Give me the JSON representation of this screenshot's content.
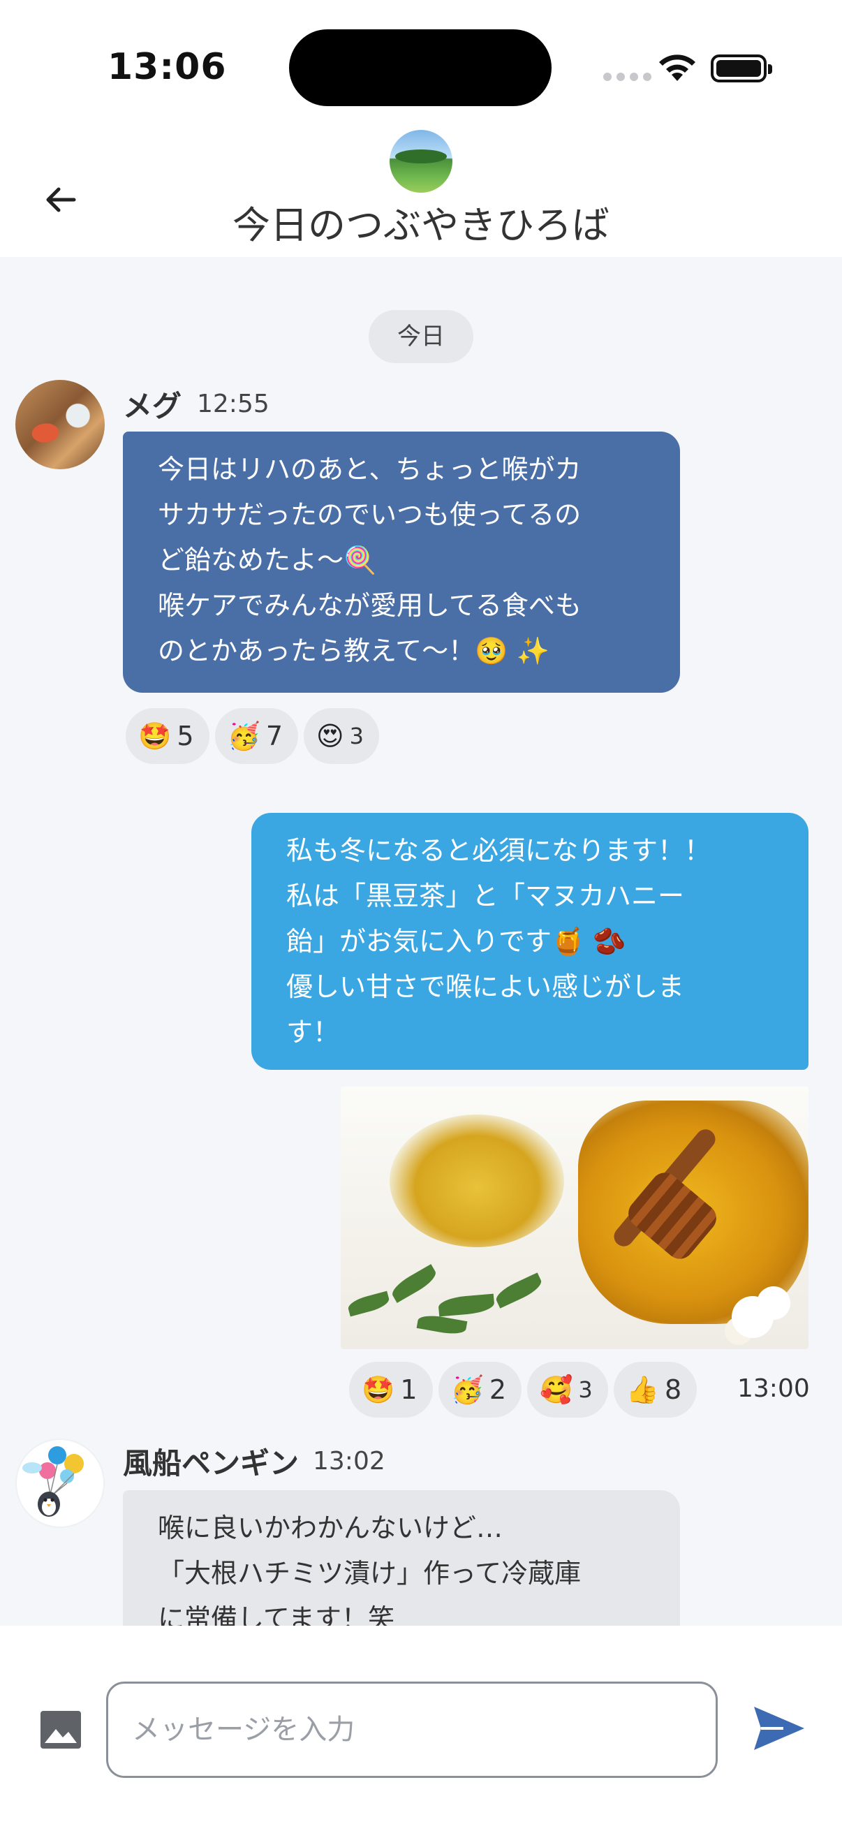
{
  "status_bar": {
    "time": "13:06"
  },
  "header": {
    "title": "今日のつぶやきひろば"
  },
  "chat": {
    "date_separator": "今日",
    "messages": [
      {
        "sender": "メグ",
        "time": "12:55",
        "lines": [
          "今日はリハのあと、ちょっと喉がカ",
          "サカサだったのでいつも使ってるの",
          "ど飴なめたよ〜🍭",
          "喉ケアでみんなが愛用してる食べも",
          "のとかあったら教えて〜！🥹 ✨"
        ],
        "reactions": [
          {
            "emoji": "🤩",
            "count": "5"
          },
          {
            "emoji": "🥳",
            "count": "7"
          },
          {
            "emoji": "😍",
            "count": "3"
          }
        ]
      },
      {
        "sender": "me",
        "time": "13:00",
        "lines": [
          "私も冬になると必須になります！！",
          "私は「黒豆茶」と「マヌカハニー",
          "飴」がお気に入りです🍯 🫘",
          "優しい甘さで喉によい感じがしま",
          "す！"
        ],
        "reactions": [
          {
            "emoji": "🤩",
            "count": "1"
          },
          {
            "emoji": "🥳",
            "count": "2"
          },
          {
            "emoji": "🥰",
            "count": "3"
          },
          {
            "emoji": "👍",
            "count": "8"
          }
        ]
      },
      {
        "sender": "風船ペンギン",
        "time": "13:02",
        "lines": [
          "喉に良いかわかんないけど…",
          "「大根ハチミツ漬け」作って冷蔵庫",
          "に常備してます！笑"
        ]
      }
    ]
  },
  "composer": {
    "placeholder": "メッセージを入力"
  },
  "icons": {
    "back": "arrow-left-icon",
    "image": "image-icon",
    "send": "send-icon",
    "wifi": "wifi-icon",
    "battery": "battery-icon"
  },
  "colors": {
    "incoming_blue": "#4a6ea6",
    "outgoing": "#3aa7e3",
    "incoming_gray": "#e6e7ea",
    "send_accent": "#3d6bb3"
  }
}
